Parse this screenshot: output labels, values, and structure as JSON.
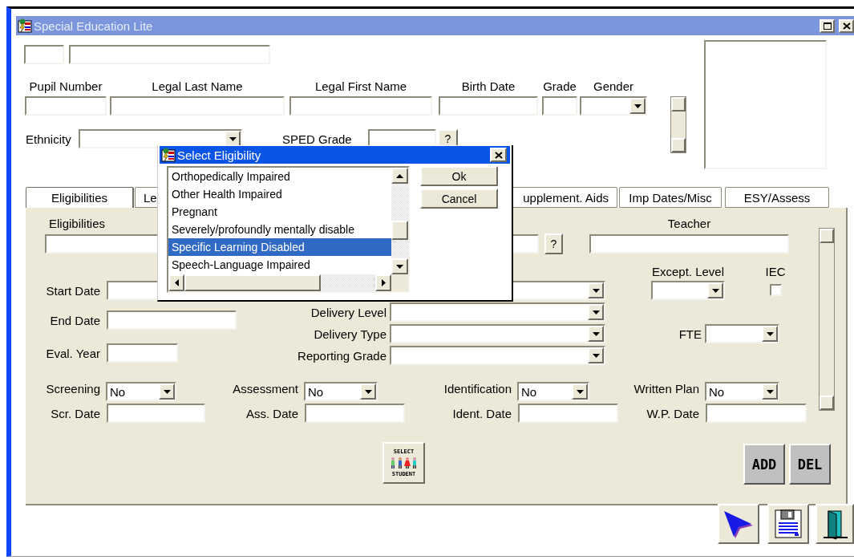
{
  "window": {
    "title": "Special Education Lite"
  },
  "pupil_labels": [
    "Pupil Number",
    "Legal Last Name",
    "Legal First Name",
    "Birth Date",
    "Grade",
    "Gender"
  ],
  "ethnicity_label": "Ethnicity",
  "sped_grade": {
    "label": "SPED Grade",
    "lookup_button": "?"
  },
  "tabs": [
    {
      "label": "Eligibilities",
      "selected": true
    },
    {
      "label": "Le",
      "selected": false
    },
    {
      "label": "upplement. Aids",
      "selected": false
    },
    {
      "label": "Imp Dates/Misc",
      "selected": false
    },
    {
      "label": "ESY/Assess",
      "selected": false
    }
  ],
  "panel": {
    "eligibilities_label": "Eligibilities",
    "lookup_button": "?",
    "teacher_label": "Teacher",
    "start_date_label": "Start Date",
    "except_level_label": "Except. Level",
    "iec": {
      "label": "IEC",
      "checked": false
    },
    "end_date_label": "End Date",
    "eval_year_label": "Eval. Year",
    "delivery_labels": [
      "Delivery Level",
      "Delivery Type",
      "Reporting Grade"
    ],
    "fte_label": "FTE",
    "statuses": [
      {
        "label": "Screening",
        "value": "No",
        "date_label": "Scr. Date"
      },
      {
        "label": "Assessment",
        "value": "No",
        "date_label": "Ass. Date"
      },
      {
        "label": "Identification",
        "value": "No",
        "date_label": "Ident. Date"
      },
      {
        "label": "Written Plan",
        "value": "No",
        "date_label": "W.P. Date"
      }
    ],
    "select_student_button": {
      "top": "SELECT",
      "bottom": "STUDENT"
    },
    "add_button": "ADD",
    "del_button": "DEL"
  },
  "dialog": {
    "title": "Select Eligibility",
    "items": [
      {
        "label": "Orthopedically Impaired",
        "selected": false
      },
      {
        "label": "Other Health Impaired",
        "selected": false
      },
      {
        "label": "Pregnant",
        "selected": false
      },
      {
        "label": "Severely/profoundly mentally disable",
        "selected": false
      },
      {
        "label": "Specific Learning Disabled",
        "selected": true
      },
      {
        "label": "Speech-Language Impaired",
        "selected": false
      }
    ],
    "buttons": [
      "Ok",
      "Cancel"
    ]
  }
}
